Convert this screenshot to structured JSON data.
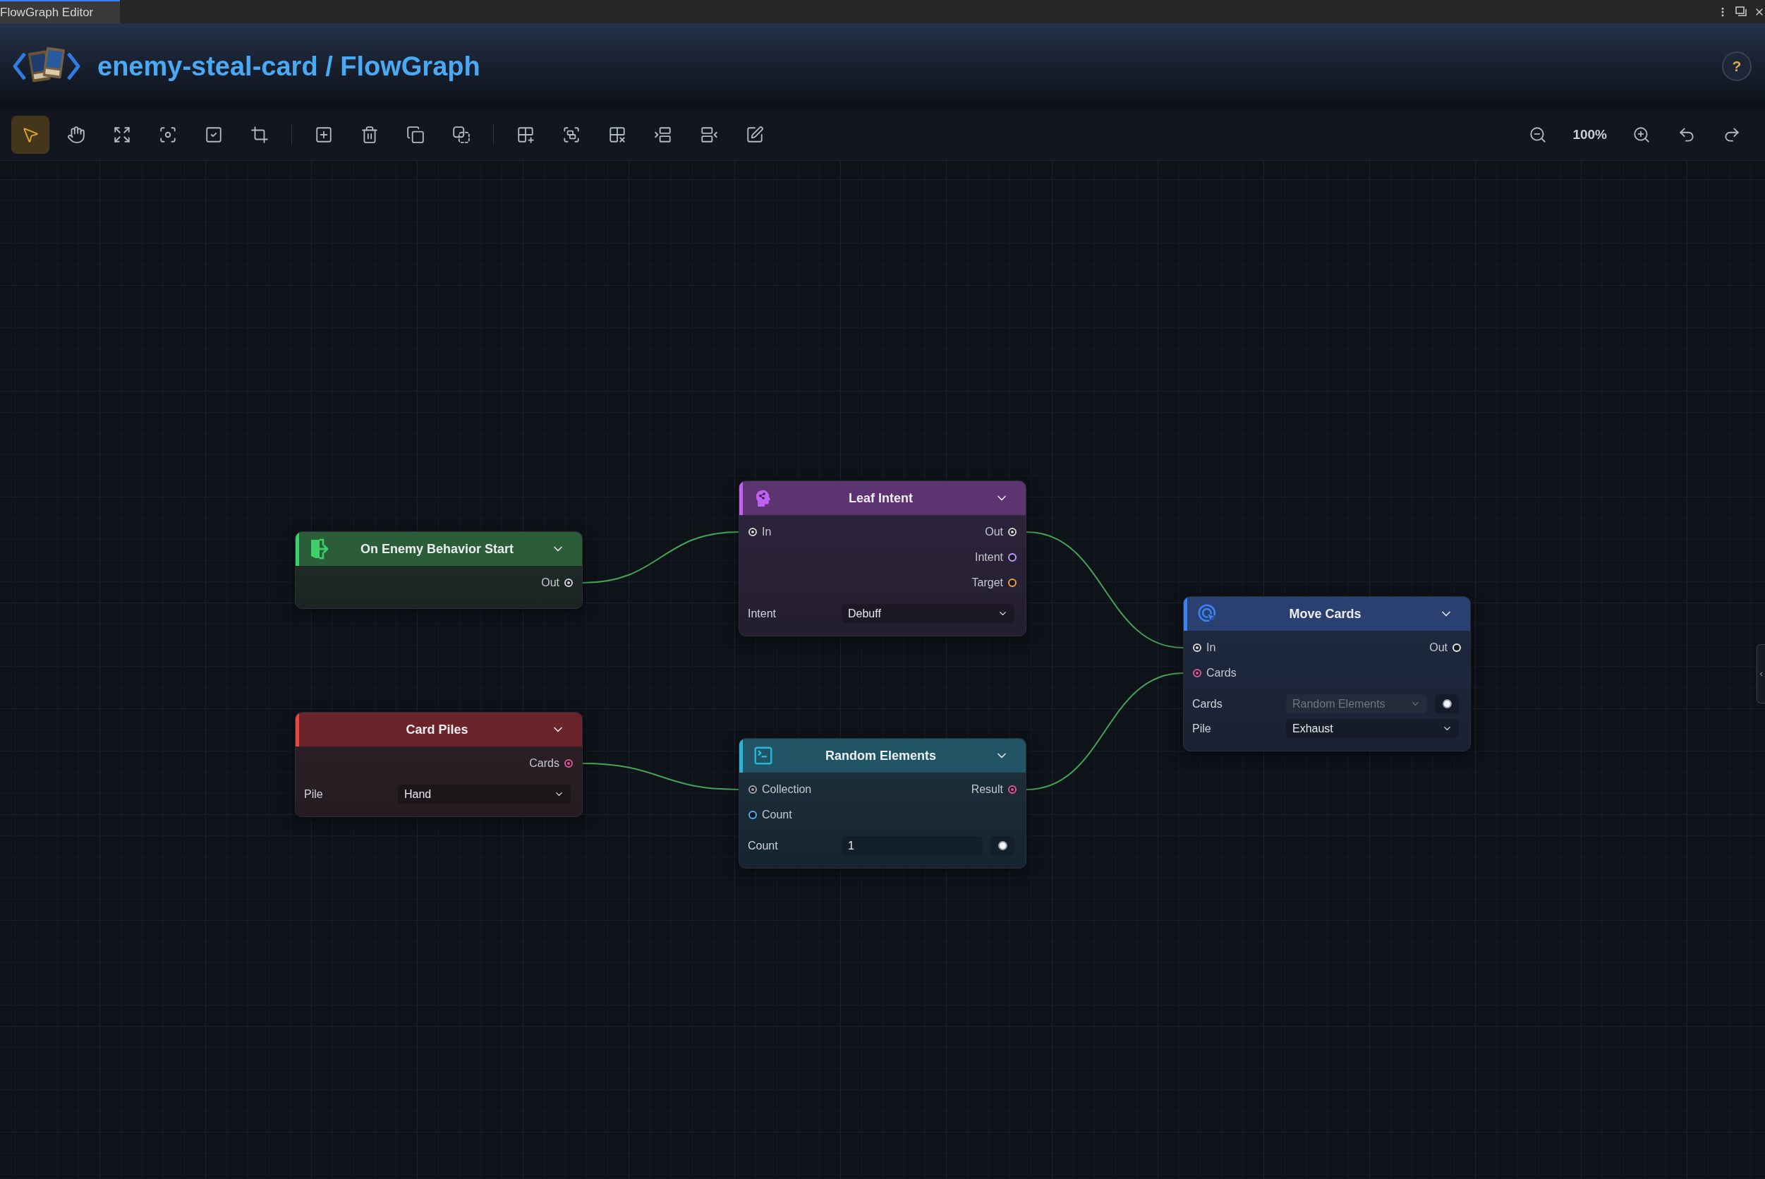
{
  "window": {
    "tab": {
      "title": "FlowGraph Editor",
      "selected": true
    }
  },
  "header": {
    "title": "enemy-steal-card / FlowGraph",
    "help_label": "?"
  },
  "toolbar": {
    "tool_groups": [
      {
        "tools": [
          {
            "kind": "select",
            "selected": true
          },
          {
            "kind": "pan",
            "selected": false
          },
          {
            "kind": "fit",
            "selected": false
          },
          {
            "kind": "focus",
            "selected": false
          },
          {
            "kind": "select-all",
            "selected": false
          },
          {
            "kind": "crop",
            "selected": false
          }
        ]
      },
      {
        "tools": [
          {
            "kind": "add",
            "selected": false
          },
          {
            "kind": "delete",
            "selected": false
          },
          {
            "kind": "duplicate",
            "selected": false
          },
          {
            "kind": "copy",
            "selected": false
          }
        ]
      },
      {
        "tools": [
          {
            "kind": "add-group",
            "selected": false
          },
          {
            "kind": "group",
            "selected": false
          },
          {
            "kind": "ungroup",
            "selected": false
          },
          {
            "kind": "insert-before",
            "selected": false
          },
          {
            "kind": "insert-after",
            "selected": false
          },
          {
            "kind": "edit",
            "selected": false
          }
        ]
      }
    ],
    "zoom": "100%"
  },
  "graph": {
    "nodes": [
      {
        "title": "On Enemy Behavior Start",
        "kind": "event",
        "color": "#3ecf6a",
        "outputs": [
          {
            "label": "Out",
            "color": "#d4d4d8",
            "connected": true
          }
        ]
      },
      {
        "title": "Card Piles",
        "kind": "data",
        "color": "#ef4444",
        "outputs": [
          {
            "label": "Cards",
            "color": "#e0559a",
            "connected": true
          }
        ],
        "fields": [
          {
            "label": "Pile",
            "kind": "dropdown",
            "value": "Hand",
            "disabled": false
          }
        ]
      },
      {
        "title": "Leaf Intent",
        "kind": "intent",
        "color": "#c061f0",
        "inputs": [
          {
            "label": "In",
            "color": "#d4d4d8",
            "connected": true
          }
        ],
        "outputs": [
          {
            "label": "Out",
            "color": "#d4d4d8",
            "connected": true
          },
          {
            "label": "Intent",
            "color": "#c39af5",
            "connected": false
          },
          {
            "label": "Target",
            "color": "#f59e3b",
            "connected": false
          }
        ],
        "fields": [
          {
            "label": "Intent",
            "kind": "dropdown",
            "value": "Debuff",
            "disabled": false
          }
        ]
      },
      {
        "title": "Random Elements",
        "kind": "function",
        "color": "#2ab4d8",
        "inputs": [
          {
            "label": "Collection",
            "color": "#9ca3af",
            "connected": true
          },
          {
            "label": "Count",
            "color": "#5aa9f0",
            "connected": false
          }
        ],
        "outputs": [
          {
            "label": "Result",
            "color": "#e0559a",
            "connected": true
          }
        ],
        "fields": [
          {
            "label": "Count",
            "kind": "number",
            "value": "1",
            "disabled": false,
            "toggle": true
          }
        ]
      },
      {
        "title": "Move Cards",
        "kind": "action",
        "color": "#3b82f6",
        "inputs": [
          {
            "label": "In",
            "color": "#d4d4d8",
            "connected": true
          },
          {
            "label": "Cards",
            "color": "#e0559a",
            "connected": true
          }
        ],
        "outputs": [
          {
            "label": "Out",
            "color": "#e5e7eb",
            "connected": false
          }
        ],
        "fields": [
          {
            "label": "Cards",
            "kind": "dropdown",
            "value": "Random Elements",
            "disabled": true,
            "toggle": true
          },
          {
            "label": "Pile",
            "kind": "dropdown",
            "value": "Exhaust",
            "disabled": false
          }
        ]
      }
    ]
  }
}
